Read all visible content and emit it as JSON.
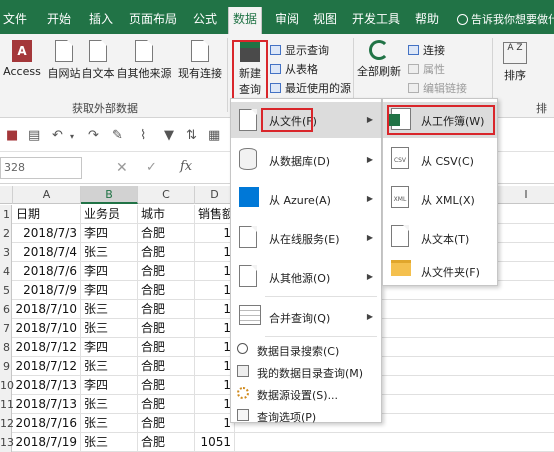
{
  "tabs": [
    "文件",
    "开始",
    "插入",
    "页面布局",
    "公式",
    "数据",
    "审阅",
    "视图",
    "开发工具",
    "帮助"
  ],
  "active_tab": "数据",
  "tell_me": "告诉我你想要做什么",
  "ribbon": {
    "external": {
      "access": "Access",
      "web": "自网站",
      "text": "自文本",
      "other_l1": "自其他来源",
      "existing": "现有连接",
      "group_label": "获取外部数据"
    },
    "new_query_l1": "新建",
    "new_query_l2": "查询",
    "show_queries": "显示查询",
    "from_table": "从表格",
    "recent_sources": "最近使用的源",
    "refresh_all": "全部刷新",
    "connections": "连接",
    "properties": "属性",
    "edit_links": "编辑链接",
    "sort": "排序",
    "sort_group_partial": "排序"
  },
  "namebox": "328",
  "fx": "fx",
  "columns": [
    "A",
    "B",
    "C",
    "D"
  ],
  "extra_col_label": "I",
  "rows": [
    {
      "n": "1",
      "a": "日期",
      "b": "业务员",
      "c": "城市",
      "d": "销售额"
    },
    {
      "n": "2",
      "a": "2018/7/3",
      "b": "李四",
      "c": "合肥",
      "d": "1"
    },
    {
      "n": "3",
      "a": "2018/7/4",
      "b": "张三",
      "c": "合肥",
      "d": "1"
    },
    {
      "n": "4",
      "a": "2018/7/6",
      "b": "李四",
      "c": "合肥",
      "d": "1"
    },
    {
      "n": "5",
      "a": "2018/7/9",
      "b": "李四",
      "c": "合肥",
      "d": "1"
    },
    {
      "n": "6",
      "a": "2018/7/10",
      "b": "张三",
      "c": "合肥",
      "d": "1"
    },
    {
      "n": "7",
      "a": "2018/7/10",
      "b": "张三",
      "c": "合肥",
      "d": "1"
    },
    {
      "n": "8",
      "a": "2018/7/12",
      "b": "李四",
      "c": "合肥",
      "d": "1"
    },
    {
      "n": "9",
      "a": "2018/7/12",
      "b": "张三",
      "c": "合肥",
      "d": "1"
    },
    {
      "n": "10",
      "a": "2018/7/13",
      "b": "李四",
      "c": "合肥",
      "d": "1"
    },
    {
      "n": "11",
      "a": "2018/7/13",
      "b": "张三",
      "c": "合肥",
      "d": "1"
    },
    {
      "n": "12",
      "a": "2018/7/16",
      "b": "张三",
      "c": "合肥",
      "d": "1"
    },
    {
      "n": "13",
      "a": "2018/7/19",
      "b": "张三",
      "c": "合肥",
      "d": "1051"
    }
  ],
  "menu1": {
    "from_file": "从文件(F)",
    "from_database": "从数据库(D)",
    "from_azure": "从 Azure(A)",
    "from_online": "从在线服务(E)",
    "from_other": "从其他源(O)",
    "combine": "合并查询(Q)",
    "catalog_search": "数据目录搜索(C)",
    "my_catalog": "我的数据目录查询(M)",
    "source_settings": "数据源设置(S)...",
    "query_options": "查询选项(P)"
  },
  "menu2": {
    "from_workbook": "从工作簿(W)",
    "from_csv": "从 CSV(C)",
    "from_xml": "从 XML(X)",
    "from_text": "从文本(T)",
    "from_folder": "从文件夹(F)",
    "csv_icon": "CSV",
    "xml_icon": "XML"
  },
  "colors": {
    "excel_green": "#217346",
    "highlight_red": "#d9262b",
    "windows_blue": "#0078d7",
    "folder_yellow": "#f4c04e"
  }
}
